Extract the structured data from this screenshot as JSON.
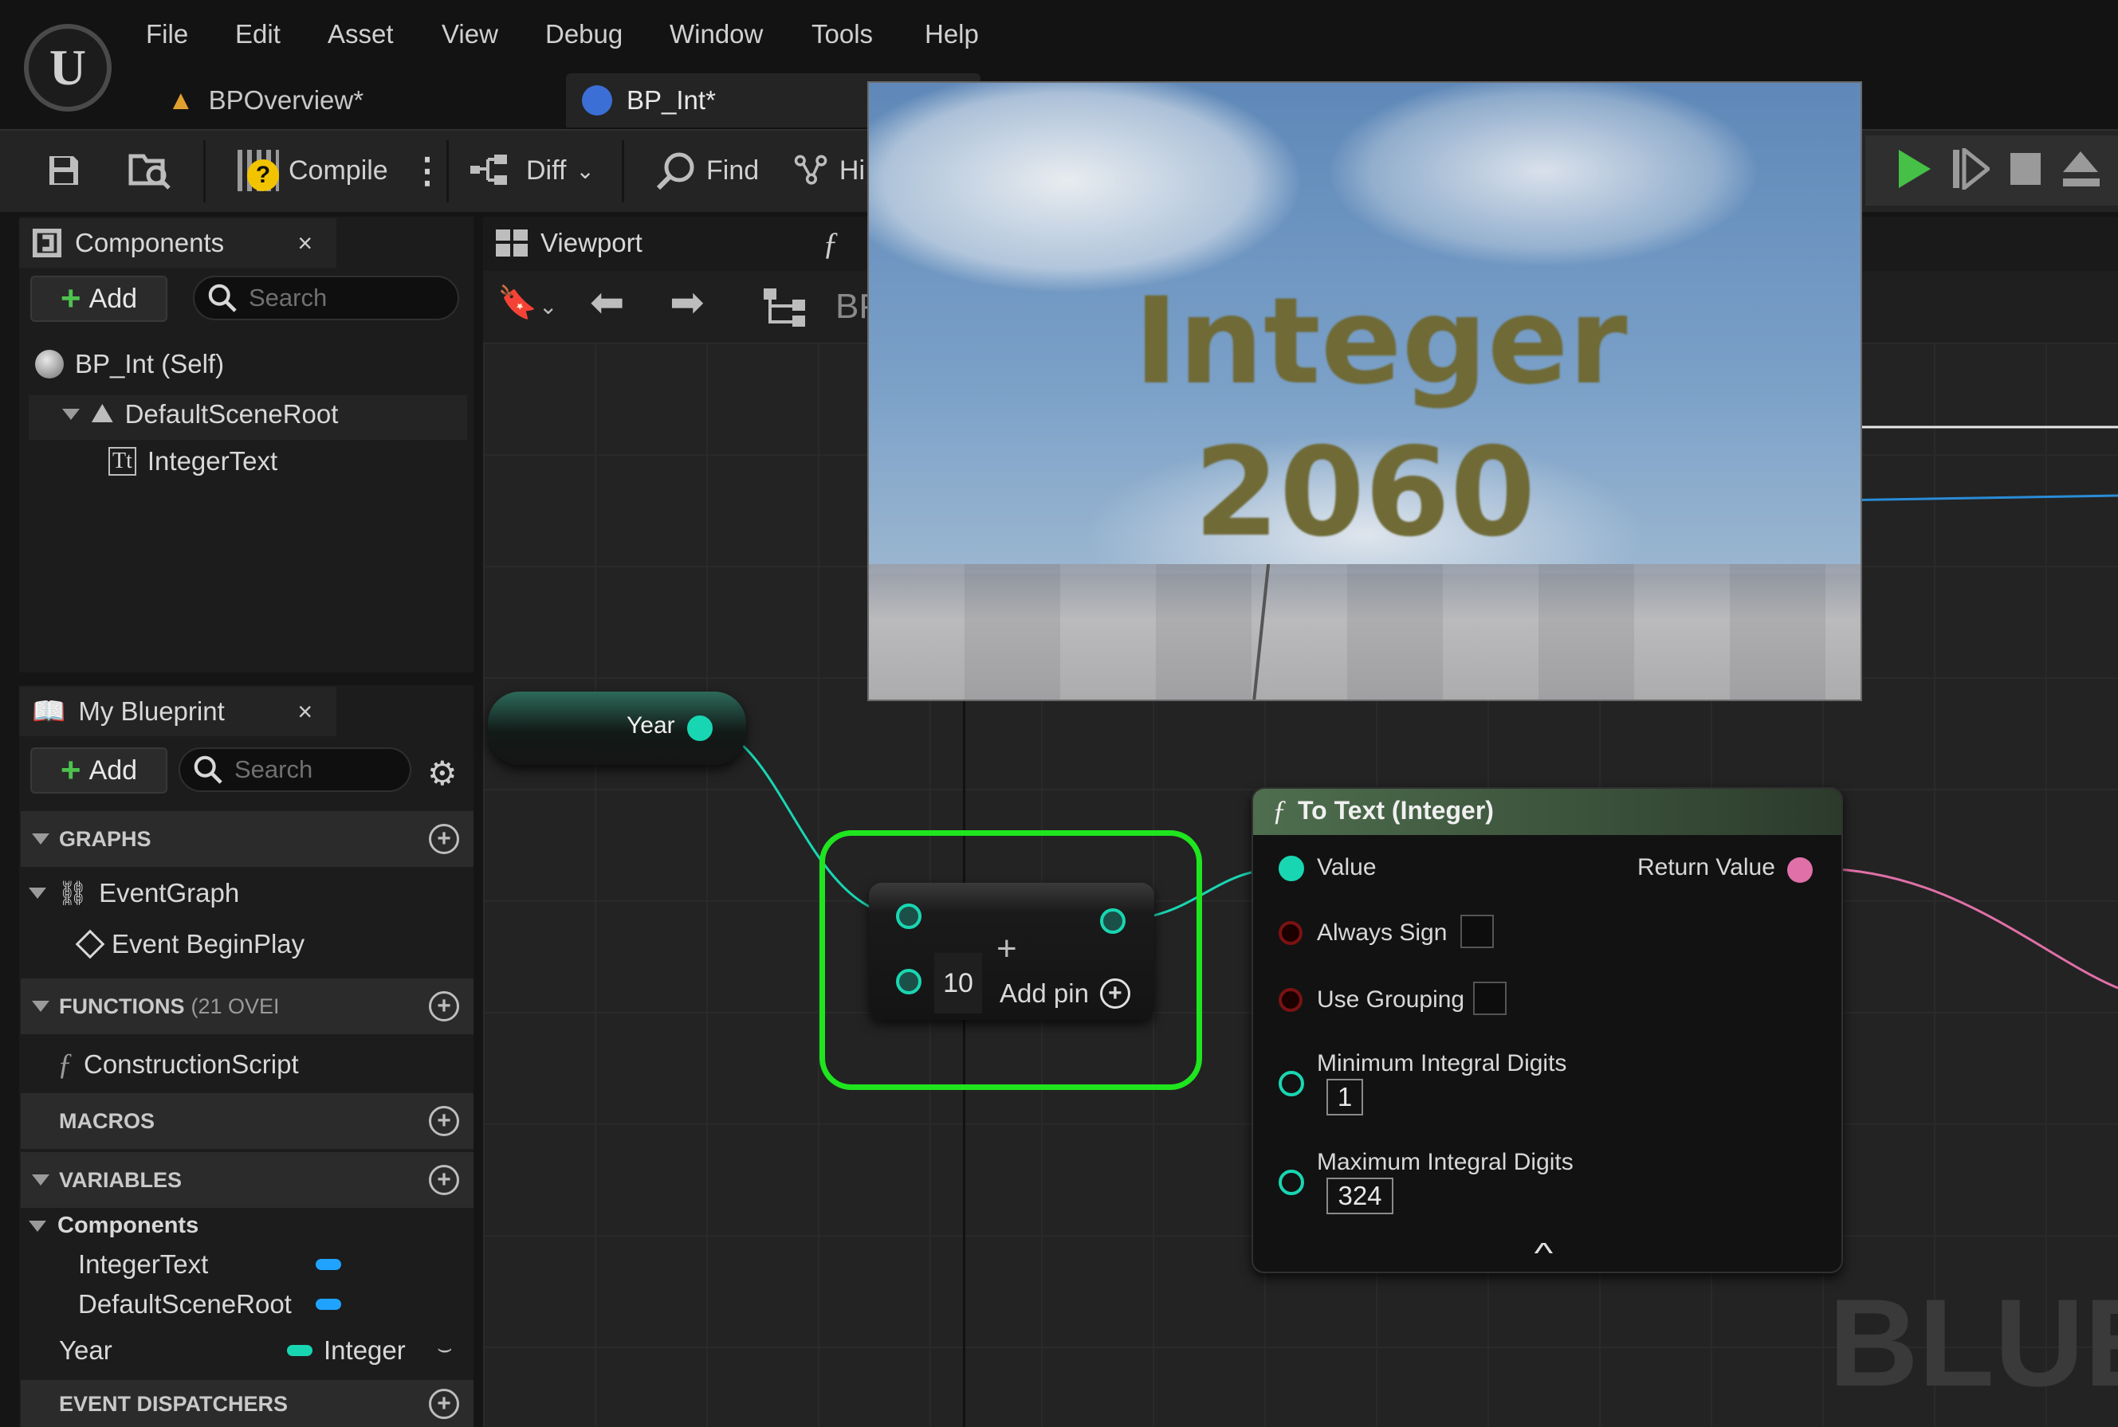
{
  "menu": [
    "File",
    "Edit",
    "Asset",
    "View",
    "Debug",
    "Window",
    "Tools",
    "Help"
  ],
  "tabs": [
    {
      "label": "BPOverview*"
    },
    {
      "label": "BP_Int*"
    }
  ],
  "toolbar": {
    "compile": "Compile",
    "diff": "Diff",
    "find": "Find",
    "hide_label": "Hi"
  },
  "components": {
    "title": "Components",
    "add": "Add",
    "search_placeholder": "Search",
    "tree": [
      {
        "label": "BP_Int (Self)"
      },
      {
        "label": "DefaultSceneRoot"
      },
      {
        "label": "IntegerText"
      }
    ]
  },
  "editor_tabs": {
    "viewport": "Viewport",
    "func_glyph": "ƒ",
    "bp_label": "BP"
  },
  "my_blueprint": {
    "title": "My Blueprint",
    "add": "Add",
    "search_placeholder": "Search",
    "sections": {
      "graphs": "GRAPHS",
      "functions": "FUNCTIONS",
      "functions_count": "(21 OVEI",
      "macros": "MACROS",
      "variables": "VARIABLES",
      "event_dispatchers": "EVENT DISPATCHERS"
    },
    "graphs": [
      {
        "label": "EventGraph"
      },
      {
        "label": "Event BeginPlay"
      }
    ],
    "functions": [
      {
        "label": "ConstructionScript"
      }
    ],
    "variables": {
      "group": "Components",
      "items": [
        {
          "label": "IntegerText"
        },
        {
          "label": "DefaultSceneRoot"
        }
      ],
      "year": {
        "label": "Year",
        "type": "Integer"
      }
    }
  },
  "viewport_preview": {
    "line1": "Integer",
    "line2": "2060"
  },
  "nodes": {
    "year_node": {
      "label": "Year"
    },
    "add_node": {
      "value": "10",
      "add_pin": "Add pin",
      "plus": "+"
    },
    "to_text": {
      "title": "To Text (Integer)",
      "value": "Value",
      "return_value": "Return Value",
      "always_sign": "Always Sign",
      "use_grouping": "Use Grouping",
      "min_digits": "Minimum Integral Digits",
      "min_value": "1",
      "max_digits": "Maximum Integral Digits",
      "max_value": "324"
    }
  },
  "watermark": "BLUEI",
  "colors": {
    "accent_green": "#1fe51f",
    "int_pin": "#19d6b2",
    "text_pin": "#e070a8",
    "func_header": "#4e6e4e",
    "play": "#46c046"
  }
}
